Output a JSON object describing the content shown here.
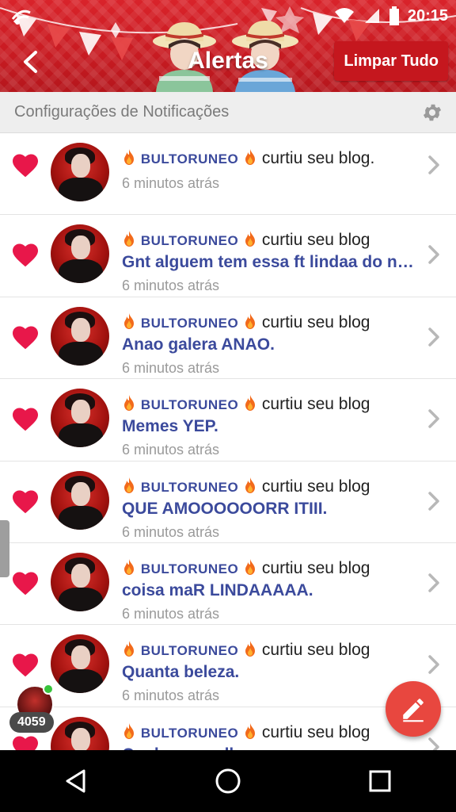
{
  "status_bar": {
    "time": "20:15"
  },
  "header": {
    "title": "Alertas",
    "clear_button": "Limpar Tudo"
  },
  "settings": {
    "label": "Configurações de Notificações"
  },
  "notifications": [
    {
      "user": "BULTORUNEO",
      "action": "curtiu seu blog.",
      "title": "",
      "time": "6 minutos atrás"
    },
    {
      "user": "BULTORUNEO",
      "action": "curtiu seu blog",
      "title": "Gnt alguem tem essa ft lindaa do nam d...",
      "time": "6 minutos atrás"
    },
    {
      "user": "BULTORUNEO",
      "action": "curtiu seu blog",
      "title": "Anao galera ANAO.",
      "time": "6 minutos atrás"
    },
    {
      "user": "BULTORUNEO",
      "action": "curtiu seu blog",
      "title": "Memes YEP.",
      "time": "6 minutos atrás"
    },
    {
      "user": "BULTORUNEO",
      "action": "curtiu seu blog",
      "title": "QUE AMOOOOOORR ITIII.",
      "time": "6 minutos atrás"
    },
    {
      "user": "BULTORUNEO",
      "action": "curtiu seu blog",
      "title": "coisa maR LINDAAAAA.",
      "time": "6 minutos atrás"
    },
    {
      "user": "BULTORUNEO",
      "action": "curtiu seu blog",
      "title": "Quanta beleza.",
      "time": "6 minutos atrás"
    },
    {
      "user": "BULTORUNEO",
      "action": "curtiu seu blog",
      "title": "Qual vc escolhe.",
      "time": ""
    }
  ],
  "floating": {
    "count": "4059"
  },
  "icons": {
    "back": "back-arrow-icon",
    "gear": "gear-icon",
    "heart": "heart-icon",
    "fire": "fire-icon",
    "chevron": "chevron-right-icon",
    "edit": "pencil-icon",
    "nav_back": "triangle-back-icon",
    "nav_home": "circle-home-icon",
    "nav_recent": "square-recent-icon"
  },
  "colors": {
    "header": "#d9232a",
    "heart": "#e8174a",
    "username": "#3b4a9c",
    "fab": "#e8473f"
  }
}
